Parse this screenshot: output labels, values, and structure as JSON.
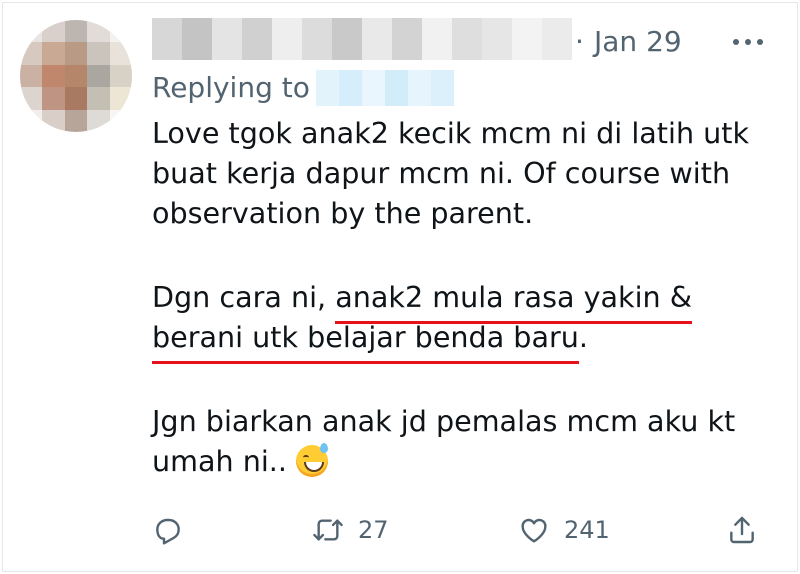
{
  "tweet": {
    "author_name_blurred": "",
    "date_separator": "·",
    "date": "Jan 29",
    "replying_label": "Replying to",
    "reply_handle_blurred": "",
    "body": {
      "p1": [
        "Love tgok anak2 kecik mcm ni di latih utk",
        "buat kerja dapur mcm ni. Of course with",
        "observation by the parent."
      ],
      "p2_prefix": "Dgn cara ni, ",
      "p2_highlight_1": "anak2 mula rasa yakin &",
      "p2_highlight_2": "berani utk belajar benda baru",
      "p2_suffix": ".",
      "p3": [
        "Jgn biarkan anak jd pemalas mcm aku kt",
        "umah ni.. "
      ]
    },
    "emoji_icon": "grinning-face-with-sweat-icon"
  },
  "actions": {
    "reply_icon": "reply-icon",
    "retweet_icon": "retweet-icon",
    "retweet_count": "27",
    "like_icon": "heart-icon",
    "like_count": "241",
    "share_icon": "share-icon"
  },
  "colors": {
    "text": "#0f1419",
    "secondary": "#536471",
    "underline": "#e8101b"
  }
}
